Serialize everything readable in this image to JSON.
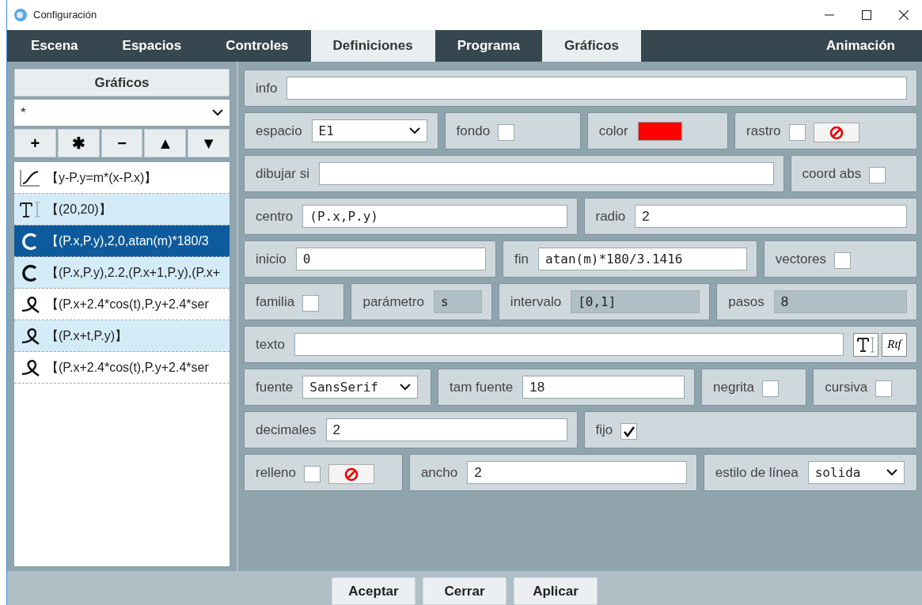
{
  "window": {
    "title": "Configuración"
  },
  "tabs": [
    {
      "label": "Escena",
      "selected": false
    },
    {
      "label": "Espacios",
      "selected": false
    },
    {
      "label": "Controles",
      "selected": false
    },
    {
      "label": "Definiciones",
      "selected": true
    },
    {
      "label": "Programa",
      "selected": false
    },
    {
      "label": "Gráficos",
      "selected": true
    },
    {
      "label": "Animación",
      "selected": false
    }
  ],
  "sidebar": {
    "title": "Gráficos",
    "filter": "*",
    "tools": [
      "+",
      "✱",
      "−",
      "▲",
      "▼"
    ],
    "items": [
      {
        "kind": "graph",
        "label": "【y-P.y=m*(x-P.x)】",
        "selected": false
      },
      {
        "kind": "text",
        "label": "【(20,20)】",
        "selected": false
      },
      {
        "kind": "arc",
        "label": "【(P.x,P.y),2,0,atan(m)*180/3",
        "selected": true
      },
      {
        "kind": "arc",
        "label": "【(P.x,P.y),2.2,(P.x+1,P.y),(P.x+",
        "selected": false
      },
      {
        "kind": "curve",
        "label": "【(P.x+2.4*cos(t),P.y+2.4*ser",
        "selected": false
      },
      {
        "kind": "curve",
        "label": "【(P.x+t,P.y)】",
        "selected": false
      },
      {
        "kind": "curve",
        "label": "【(P.x+2.4*cos(t),P.y+2.4*ser",
        "selected": false
      }
    ]
  },
  "form": [
    [
      {
        "kind": "text",
        "label": "info"
      }
    ],
    [
      {
        "kind": "select",
        "label": "espacio",
        "value": "E1"
      },
      {
        "kind": "checkbox",
        "label": "fondo",
        "checked": false
      },
      {
        "kind": "color",
        "label": "color",
        "color": "#ff0000"
      },
      {
        "kind": "checkbox",
        "label": "rastro",
        "checked": false,
        "no_color_button": true
      }
    ],
    [
      {
        "kind": "text",
        "label": "dibujar si"
      },
      {
        "kind": "checkbox",
        "label": "coord abs",
        "checked": false
      }
    ],
    [
      {
        "kind": "code",
        "label": "centro",
        "value": "(P.x,P.y)"
      },
      {
        "kind": "text",
        "label": "radio",
        "value": "2"
      }
    ],
    [
      {
        "kind": "code",
        "label": "inicio",
        "value": "0"
      },
      {
        "kind": "code",
        "label": "fin",
        "value": "atan(m)*180/3.1416"
      },
      {
        "kind": "checkbox",
        "label": "vectores",
        "checked": false
      }
    ],
    [
      {
        "kind": "checkbox",
        "label": "familia",
        "checked": false
      },
      {
        "kind": "code",
        "label": "parámetro",
        "value": "s",
        "disabled": true
      },
      {
        "kind": "code",
        "label": "intervalo",
        "value": "[0,1]",
        "disabled": true
      },
      {
        "kind": "text",
        "label": "pasos",
        "value": "8",
        "disabled": true
      }
    ],
    [
      {
        "kind": "text",
        "label": "texto",
        "buttons": [
          {
            "kind": "icon"
          },
          {
            "kind": "label",
            "text": "Rtf"
          }
        ]
      }
    ],
    [
      {
        "kind": "select",
        "label": "fuente",
        "value": "SansSerif"
      },
      {
        "kind": "text",
        "label": "tam fuente",
        "value": "18"
      },
      {
        "kind": "checkbox",
        "label": "negrita",
        "checked": false
      },
      {
        "kind": "checkbox",
        "label": "cursiva",
        "checked": false
      }
    ],
    [
      {
        "kind": "text",
        "label": "decimales",
        "value": "2"
      },
      {
        "kind": "checkbox",
        "label": "fijo",
        "checked": true
      }
    ],
    [
      {
        "kind": "checkbox",
        "label": "relleno",
        "checked": false,
        "no_color_button": true
      },
      {
        "kind": "text",
        "label": "ancho",
        "value": "2"
      },
      {
        "kind": "select",
        "label": "estilo de línea",
        "value": "solida"
      }
    ]
  ],
  "buttons": [
    "Aceptar",
    "Cerrar",
    "Aplicar"
  ]
}
